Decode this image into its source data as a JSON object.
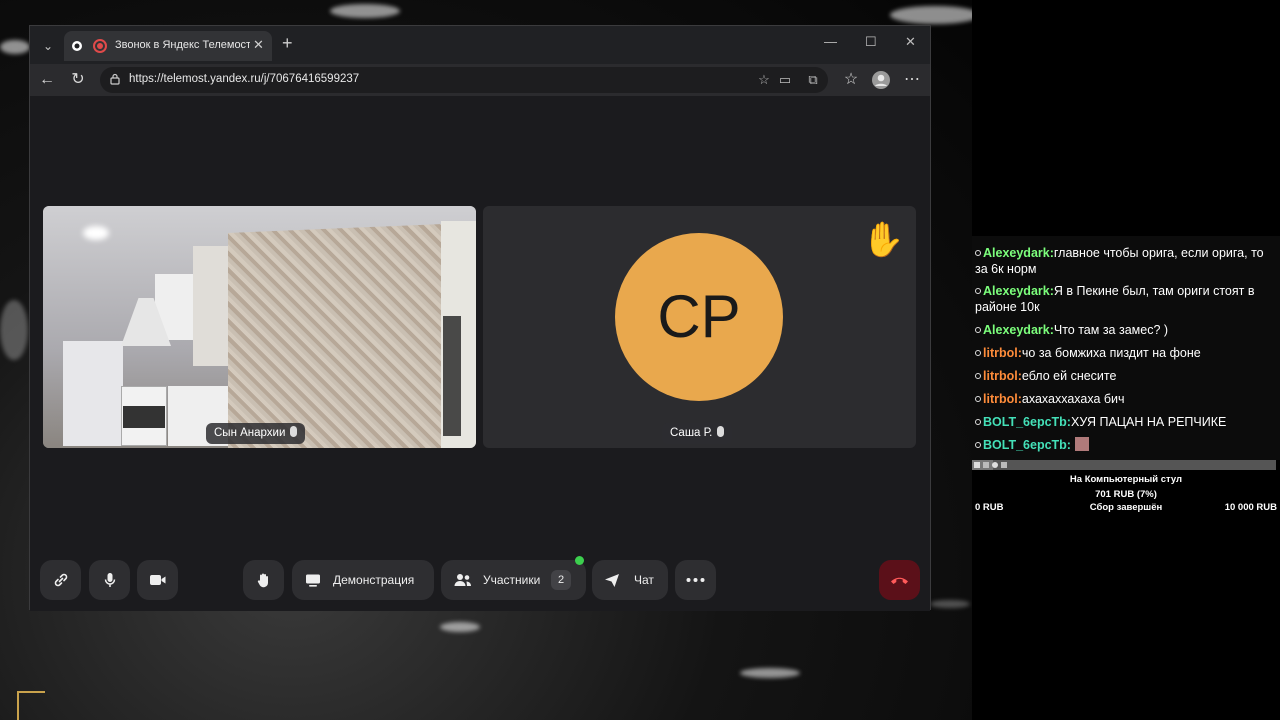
{
  "browser": {
    "tab_title": "Звонок в Яндекс Телемосте",
    "url": "https://telemost.yandex.ru/j/70676416599237",
    "window_controls": [
      "minimize-icon",
      "maximize-icon",
      "close-icon"
    ]
  },
  "call": {
    "participants": [
      {
        "name": "Сын Анархии",
        "video": true
      },
      {
        "name": "Саша Р.",
        "initials": "СР",
        "avatar_color": "#e9a84d",
        "hand_raised": true
      }
    ]
  },
  "toolbar": {
    "demo_label": "Демонстрация",
    "participants_label": "Участники",
    "participants_count": "2",
    "chat_label": "Чат"
  },
  "chat": {
    "messages": [
      {
        "user": "Alexeydark:",
        "color": "#7cff7c",
        "text": "главное чтобы орига, если орига, то за 6к норм"
      },
      {
        "user": "Alexeydark:",
        "color": "#7cff7c",
        "text": "Я в Пекине был, там ориги стоят в районе 10к"
      },
      {
        "user": "Alexeydark:",
        "color": "#7cff7c",
        "text": "Что там за замес? )"
      },
      {
        "user": "litrbol:",
        "color": "#ff8c3a",
        "text": "чо за бомжиха пиздит на фоне"
      },
      {
        "user": "litrbol:",
        "color": "#ff8c3a",
        "text": "ебло ей снесите"
      },
      {
        "user": "litrbol:",
        "color": "#ff8c3a",
        "text": "ахахаххахаха бич"
      },
      {
        "user": "BOLT_6ерсТb:",
        "color": "#44e0b8",
        "text": "ХУЯ ПАЦАН НА РЕПЧИКЕ"
      },
      {
        "user": "BOLT_6ерсТb:",
        "color": "#44e0b8",
        "text": ""
      }
    ]
  },
  "donation_goal": {
    "title": "На Компьютерный стул",
    "amount": "701 RUB (7%)",
    "progress": 0.07,
    "min": "0 RUB",
    "status": "Сбор завершён",
    "max": "10 000 RUB"
  }
}
